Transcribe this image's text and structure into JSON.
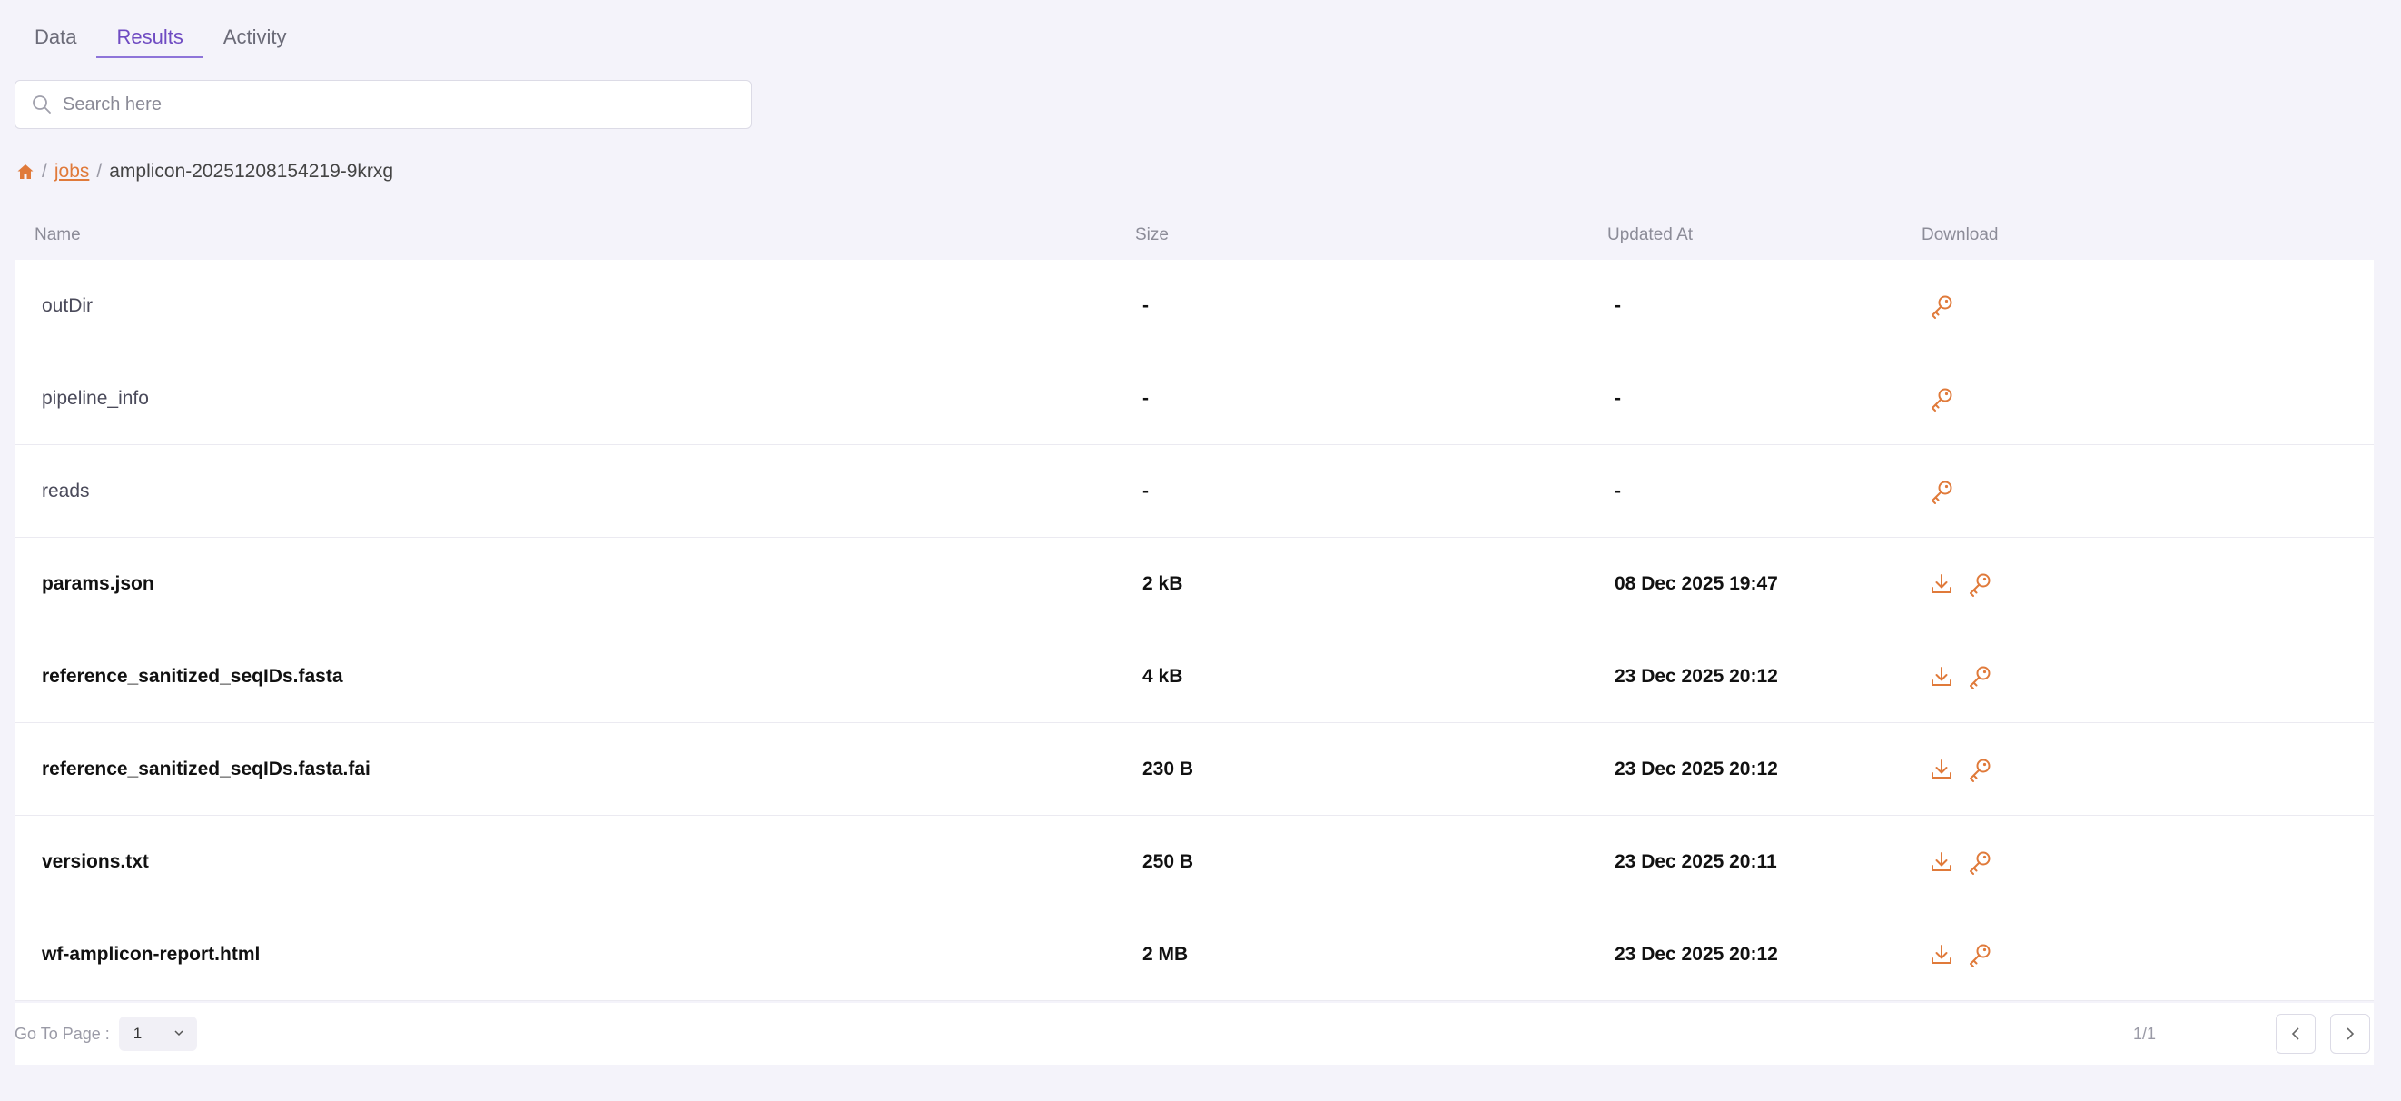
{
  "tabs": [
    {
      "label": "Data",
      "active": false
    },
    {
      "label": "Results",
      "active": true
    },
    {
      "label": "Activity",
      "active": false
    }
  ],
  "search": {
    "placeholder": "Search here",
    "value": ""
  },
  "breadcrumb": {
    "separator": "/",
    "link": "jobs",
    "current": "amplicon-20251208154219-9krxg"
  },
  "table": {
    "headers": {
      "name": "Name",
      "size": "Size",
      "updated": "Updated At",
      "download": "Download"
    },
    "rows": [
      {
        "name": "outDir",
        "size": "-",
        "updated": "-",
        "type": "dir"
      },
      {
        "name": "pipeline_info",
        "size": "-",
        "updated": "-",
        "type": "dir"
      },
      {
        "name": "reads",
        "size": "-",
        "updated": "-",
        "type": "dir"
      },
      {
        "name": "params.json",
        "size": "2 kB",
        "updated": "08 Dec 2025 19:47",
        "type": "file"
      },
      {
        "name": "reference_sanitized_seqIDs.fasta",
        "size": "4 kB",
        "updated": "23 Dec 2025 20:12",
        "type": "file"
      },
      {
        "name": "reference_sanitized_seqIDs.fasta.fai",
        "size": "230 B",
        "updated": "23 Dec 2025 20:12",
        "type": "file"
      },
      {
        "name": "versions.txt",
        "size": "250 B",
        "updated": "23 Dec 2025 20:11",
        "type": "file"
      },
      {
        "name": "wf-amplicon-report.html",
        "size": "2 MB",
        "updated": "23 Dec 2025 20:12",
        "type": "file"
      }
    ]
  },
  "footer": {
    "goto_label": "Go To Page :",
    "page_value": "1",
    "page_count": "1/1"
  },
  "colors": {
    "accent": "#e07a3a",
    "tab_active": "#6f4bc2",
    "background": "#f4f3fa"
  },
  "icons": {
    "search": "search-icon",
    "home": "home-icon",
    "download": "download-icon",
    "key": "key-icon",
    "prev": "chevron-left-icon",
    "next": "chevron-right-icon"
  }
}
